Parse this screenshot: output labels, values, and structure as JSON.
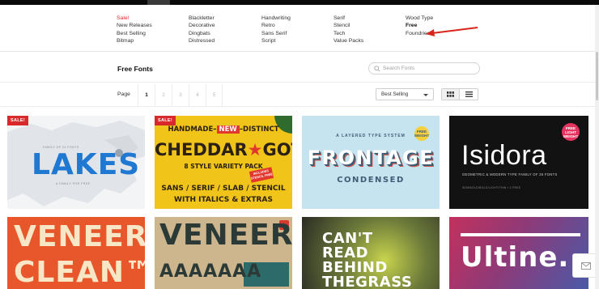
{
  "categories": {
    "col1": [
      "Sale!",
      "New Releases",
      "Best Selling",
      "Bitmap"
    ],
    "col2": [
      "Blackletter",
      "Decorative",
      "Dingbats",
      "Distressed"
    ],
    "col3": [
      "Handwriting",
      "Retro",
      "Sans Serif",
      "Script"
    ],
    "col4": [
      "Serif",
      "Stencil",
      "Tech",
      "Value Packs"
    ],
    "col5": [
      "Wood Type",
      "Free",
      "Foundries"
    ]
  },
  "page": {
    "title": "Free Fonts",
    "search_placeholder": "Search Fonts",
    "page_label": "Page",
    "pages": [
      "1",
      "2",
      "3",
      "4",
      "5"
    ],
    "current_page": "1",
    "sort_selected": "Best Selling"
  },
  "cards": {
    "lakes": {
      "badge": "SALE!",
      "title": "LAKES",
      "tagline_top": "FAMILY OF 24 FONTS",
      "tagline_bottom": "A FAMILY FOR FREE"
    },
    "cheddar": {
      "badge": "SALE!",
      "line1_a": "HANDMADE–",
      "line1_new": "NEW",
      "line1_b": "–DISTINCT",
      "title_a": "CHEDDAR",
      "title_star": "★",
      "title_b": "GOTHIC",
      "line3": "8 STYLE VARIETY PACK",
      "line4": "SANS / SERIF / SLAB / STENCIL",
      "line5": "WITH ITALICS & EXTRAS",
      "stamp": "INCLUDES STENCIL FREE"
    },
    "frontage": {
      "top": "A LAYERED TYPE SYSTEM",
      "title": "FRONTAGE",
      "sub": "CONDENSED",
      "badge": "FREE WEIGHT"
    },
    "isidora": {
      "title": "Isidora",
      "sub": "GEOMETRIC & MODERN TYPE FAMILY OF 26 FONTS",
      "foot": "SEMIBOLD/BOLD/LIGHT/THIN • 2 FREE",
      "badge": "FREE LIGHT WEIGHT"
    },
    "veneer_clean": {
      "line1": "VENEER",
      "line2": "CLEAN™"
    },
    "veneer": {
      "line1": "VENEER",
      "line2": "AAAAAAA"
    },
    "thegrass": {
      "l1": "CAN'T",
      "l2": "READ",
      "l3": "BEHIND",
      "l4": "THEGRASS"
    },
    "ultine": {
      "title": "Ultine."
    }
  },
  "colors": {
    "accent_red": "#e0262b",
    "arrow_red": "#d9261c",
    "lakes_blue": "#1f78d1"
  },
  "icons": [
    "search-icon",
    "grid-view-icon",
    "list-view-icon",
    "caret-down-icon",
    "mail-icon",
    "arrow-annotation"
  ]
}
